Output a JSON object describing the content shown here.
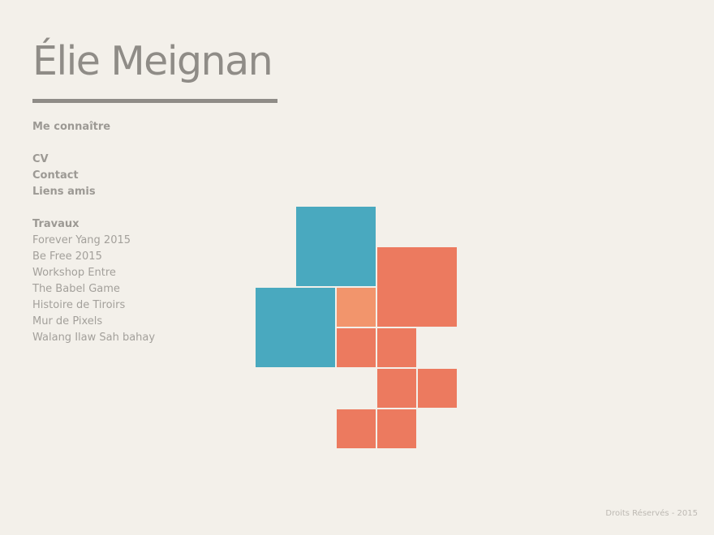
{
  "header": {
    "title": "Élie Meignan"
  },
  "nav": {
    "about_heading": "Me connaître",
    "cv": "CV",
    "contact": "Contact",
    "friends_links": "Liens amis",
    "works_heading": "Travaux",
    "works": [
      "Forever Yang 2015",
      "Be Free 2015",
      "Workshop Entre",
      "The Babel Game",
      "Histoire de Tiroirs",
      "Mur de Pixels",
      "Walang Ilaw Sah bahay"
    ]
  },
  "colors": {
    "background": "#f3f0ea",
    "text": "#8f8c87",
    "blue": "#49a9bf",
    "coral": "#ec7a5f",
    "peach": "#f2956c"
  },
  "footer": {
    "copyright": "Droits Réservés - 2015"
  }
}
